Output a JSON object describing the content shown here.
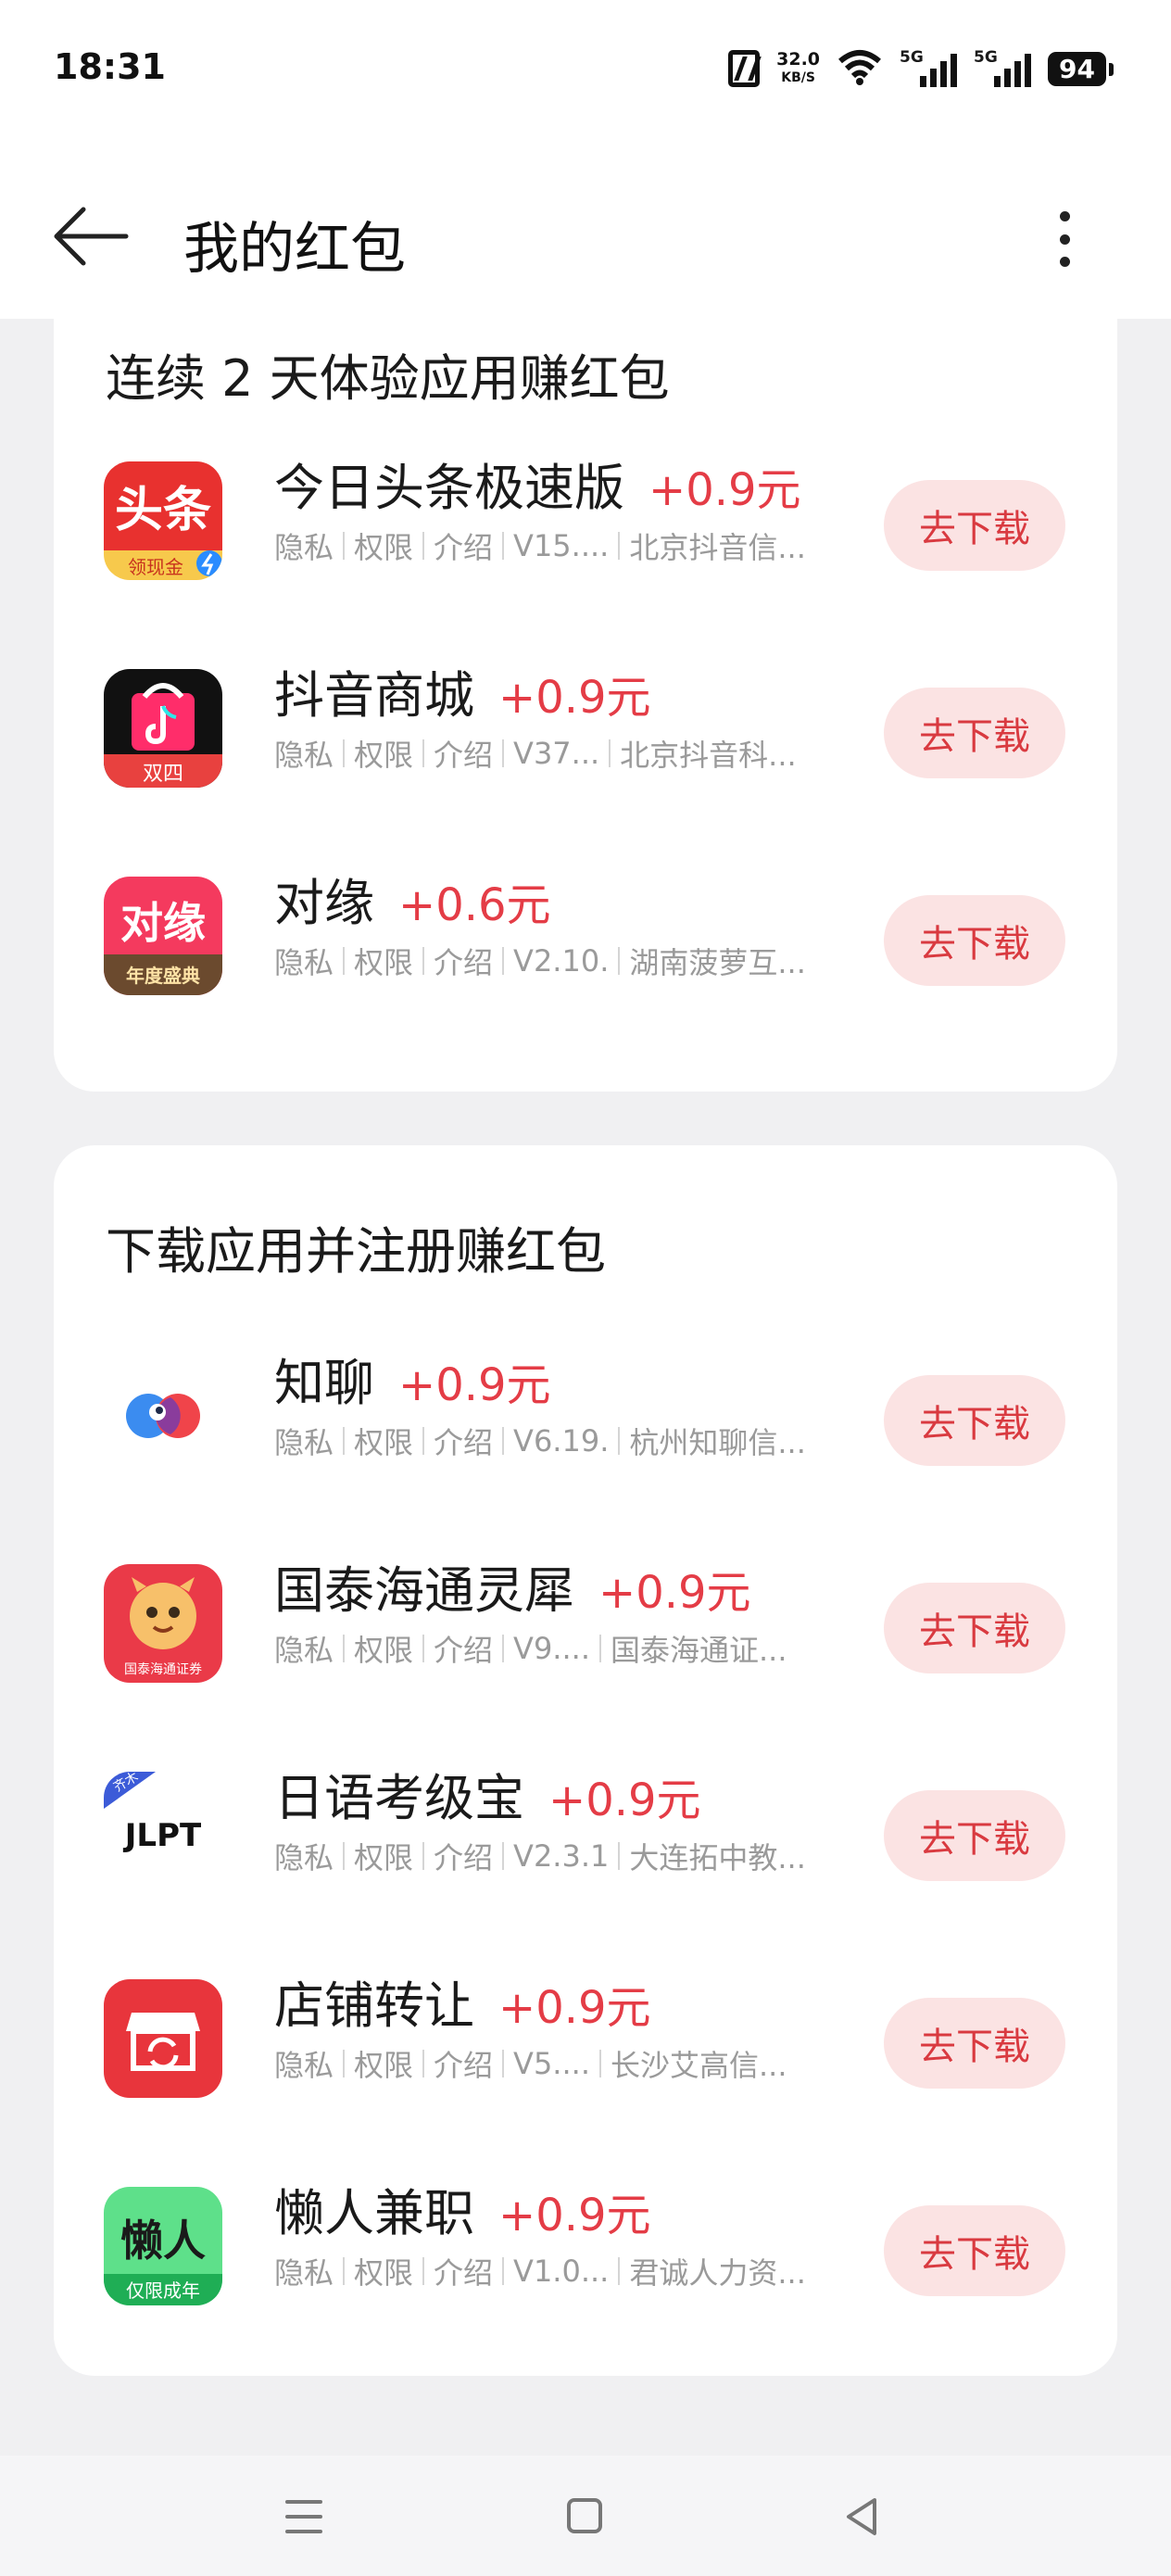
{
  "status": {
    "time": "18:31",
    "net_speed": "32.0",
    "net_unit": "KB/S",
    "sig1": "5G",
    "sig2": "5G",
    "battery": "94"
  },
  "header": {
    "title": "我的红包"
  },
  "sections": [
    {
      "title": "连续 2 天体验应用赚红包",
      "apps": [
        {
          "name": "今日头条极速版",
          "reward": "+0.9元",
          "meta": [
            "隐私",
            "权限",
            "介绍",
            "V15....",
            "北京抖音信..."
          ],
          "button": "去下载",
          "icon": "toutiao-lite-icon",
          "icon_text": "头条",
          "icon_sub": "领现金"
        },
        {
          "name": "抖音商城",
          "reward": "+0.9元",
          "meta": [
            "隐私",
            "权限",
            "介绍",
            "V37...",
            "北京抖音科..."
          ],
          "button": "去下载",
          "icon": "douyin-mall-icon",
          "icon_sub": "双四"
        },
        {
          "name": "对缘",
          "reward": "+0.6元",
          "meta": [
            "隐私",
            "权限",
            "介绍",
            "V2.10.",
            "湖南菠萝互..."
          ],
          "button": "去下载",
          "icon": "duiyuan-icon",
          "icon_text": "对缘",
          "icon_sub": "年度盛典"
        }
      ]
    },
    {
      "title": "下载应用并注册赚红包",
      "apps": [
        {
          "name": "知聊",
          "reward": "+0.9元",
          "meta": [
            "隐私",
            "权限",
            "介绍",
            "V6.19.",
            "杭州知聊信..."
          ],
          "button": "去下载",
          "icon": "zhiliao-icon"
        },
        {
          "name": "国泰海通灵犀",
          "reward": "+0.9元",
          "meta": [
            "隐私",
            "权限",
            "介绍",
            "V9....",
            "国泰海通证..."
          ],
          "button": "去下载",
          "icon": "guotai-lingxi-icon",
          "icon_sub": "国泰海通证券"
        },
        {
          "name": "日语考级宝",
          "reward": "+0.9元",
          "meta": [
            "隐私",
            "权限",
            "介绍",
            "V2.3.1",
            "大连拓中教..."
          ],
          "button": "去下载",
          "icon": "jlpt-icon",
          "icon_text": "JLPT",
          "icon_sub": "齐木"
        },
        {
          "name": "店铺转让",
          "reward": "+0.9元",
          "meta": [
            "隐私",
            "权限",
            "介绍",
            "V5....",
            "长沙艾高信..."
          ],
          "button": "去下载",
          "icon": "shop-transfer-icon"
        },
        {
          "name": "懒人兼职",
          "reward": "+0.9元",
          "meta": [
            "隐私",
            "权限",
            "介绍",
            "V1.0...",
            "君诚人力资..."
          ],
          "button": "去下载",
          "icon": "lanren-jianzhi-icon",
          "icon_text": "懒人",
          "icon_sub": "仅限成年"
        }
      ]
    }
  ]
}
